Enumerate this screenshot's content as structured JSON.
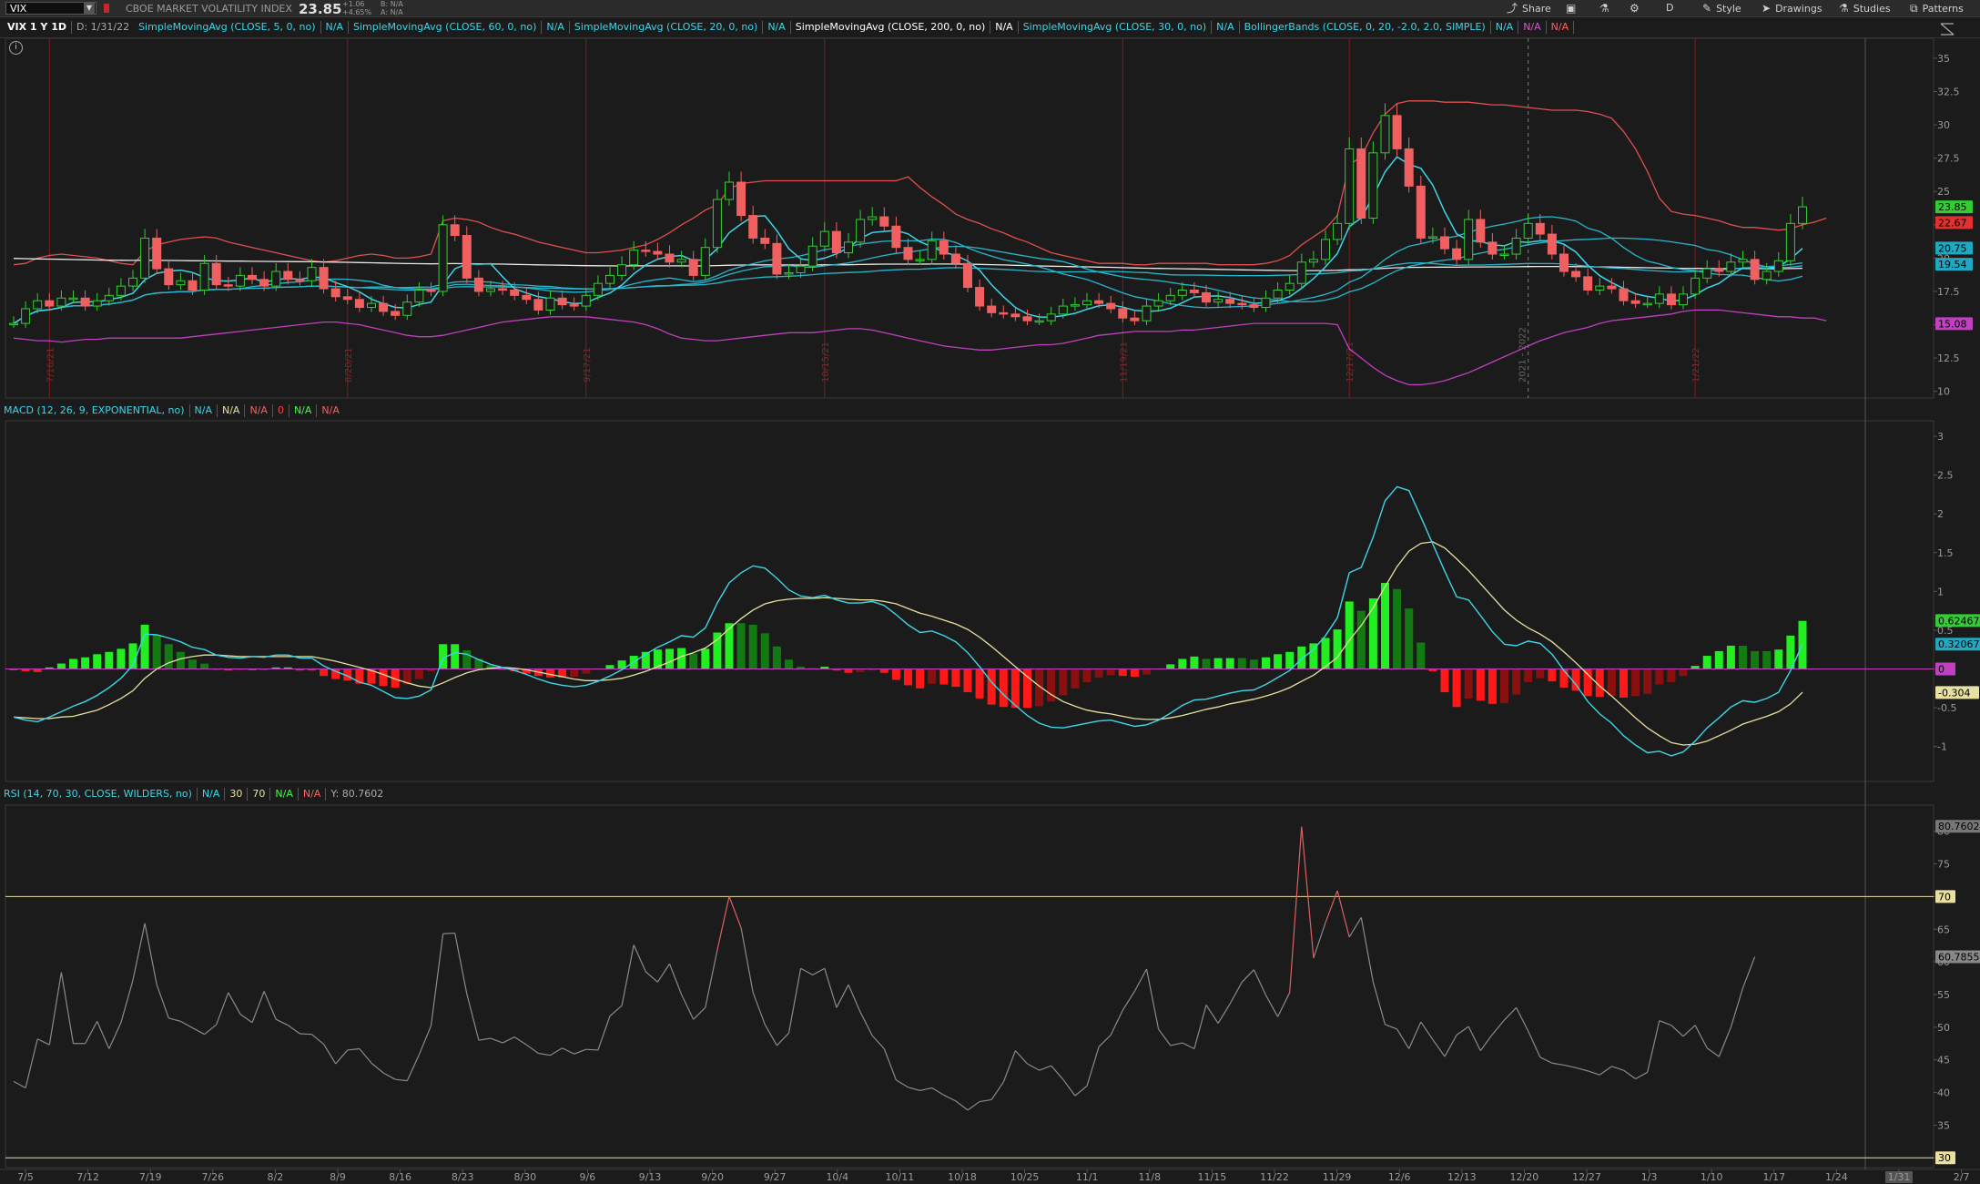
{
  "toolbar": {
    "symbol": "VIX",
    "symbol_name": "CBOE MARKET VOLATILITY INDEX",
    "last": "23.85",
    "net_change": "+1.06",
    "pct_change": "+4.65%",
    "bid": "B: N/A",
    "ask": "A: N/A",
    "buttons": [
      {
        "icon": "share-icon",
        "label": "Share",
        "glyph": "⤴"
      },
      {
        "icon": "layout-icon",
        "label": "",
        "glyph": "▣"
      },
      {
        "icon": "flask-icon",
        "label": "",
        "glyph": "⚗"
      },
      {
        "icon": "gear-icon",
        "label": "",
        "glyph": "⚙"
      },
      {
        "icon": "",
        "label": "D",
        "glyph": ""
      },
      {
        "icon": "style-icon",
        "label": "Style",
        "glyph": "✎"
      },
      {
        "icon": "cursor-icon",
        "label": "Drawings",
        "glyph": "➤"
      },
      {
        "icon": "flask-icon",
        "label": "Studies",
        "glyph": "⚗"
      },
      {
        "icon": "patterns-icon",
        "label": "Patterns",
        "glyph": "⧉"
      }
    ]
  },
  "studies": {
    "period": "VIX 1 Y 1D",
    "date": "D: 1/31/22",
    "items": [
      {
        "label": "SimpleMovingAvg (CLOSE, 5, 0, no)",
        "value": "N/A",
        "color": "#3dd6e8"
      },
      {
        "label": "SimpleMovingAvg (CLOSE, 60, 0, no)",
        "value": "N/A",
        "color": "#3dd6e8"
      },
      {
        "label": "SimpleMovingAvg (CLOSE, 20, 0, no)",
        "value": "N/A",
        "color": "#3dd6e8"
      },
      {
        "label": "SimpleMovingAvg (CLOSE, 200, 0, no)",
        "value": "N/A",
        "color": "#ffffff"
      },
      {
        "label": "SimpleMovingAvg (CLOSE, 30, 0, no)",
        "value": "N/A",
        "color": "#3dd6e8"
      },
      {
        "label": "BollingerBands (CLOSE, 0, 20, -2.0, 2.0, SIMPLE)",
        "value": "N/A",
        "color": "#3dd6e8"
      }
    ],
    "extra": [
      {
        "value": "N/A",
        "color": "#d05bd0"
      },
      {
        "value": "N/A",
        "color": "#ff6060"
      }
    ]
  },
  "macd_label": {
    "title": "MACD (12, 26, 9, EXPONENTIAL, no)",
    "values": [
      {
        "v": "N/A",
        "color": "#3dd6e8"
      },
      {
        "v": "N/A",
        "color": "#e8e0a0"
      },
      {
        "v": "N/A",
        "color": "#ff6060"
      },
      {
        "v": "0",
        "color": "#ff4040"
      },
      {
        "v": "N/A",
        "color": "#40ff40"
      },
      {
        "v": "N/A",
        "color": "#ff6060"
      }
    ]
  },
  "rsi_label": {
    "title": "RSI (14, 70, 30, CLOSE, WILDERS, no)",
    "values": [
      {
        "v": "N/A",
        "color": "#3dd6e8"
      },
      {
        "v": "30",
        "color": "#e8e0a0"
      },
      {
        "v": "70",
        "color": "#e8e0a0"
      },
      {
        "v": "N/A",
        "color": "#40ff40"
      },
      {
        "v": "N/A",
        "color": "#ff6060"
      },
      {
        "v": "Y: 80.7602",
        "color": "#aaaaaa"
      }
    ]
  },
  "chart_data": {
    "type": "candlestick",
    "x_ticks": [
      "7/5",
      "7/12",
      "7/19",
      "7/26",
      "8/2",
      "8/9",
      "8/16",
      "8/23",
      "8/30",
      "9/6",
      "9/13",
      "9/20",
      "9/27",
      "10/4",
      "10/11",
      "10/18",
      "10/25",
      "11/1",
      "11/8",
      "11/15",
      "11/22",
      "11/29",
      "12/6",
      "12/13",
      "12/20",
      "12/27",
      "1/3",
      "1/10",
      "1/17",
      "1/24",
      "1/31",
      "2/7"
    ],
    "x_highlight": "1/31",
    "price": {
      "ylim": [
        9.5,
        36.5
      ],
      "y_ticks": [
        10,
        12.5,
        15,
        17.5,
        20,
        22.5,
        25,
        27.5,
        30,
        32.5,
        35
      ],
      "markers": [
        {
          "value": 23.85,
          "label": "23.85",
          "color": "#33cc33"
        },
        {
          "value": 22.67,
          "label": "22.67",
          "color": "#e03030"
        },
        {
          "value": 20.75,
          "label": "20.75",
          "color": "#20a8c0"
        },
        {
          "value": 19.54,
          "label": "19.54",
          "color": "#20a8c0"
        },
        {
          "value": 15.08,
          "label": "15.08",
          "color": "#c040c0"
        }
      ],
      "expiration_lines": [
        {
          "label": "7/16/21",
          "i": 3
        },
        {
          "label": "8/20/21",
          "i": 28
        },
        {
          "label": "9/17/21",
          "i": 48
        },
        {
          "label": "10/15/21",
          "i": 68
        },
        {
          "label": "11/19/21",
          "i": 93
        },
        {
          "label": "12/17/21",
          "i": 112
        },
        {
          "label": "1/21/22",
          "i": 141
        }
      ],
      "year_line": {
        "label": "2021 - 2022",
        "i": 127
      },
      "closes": [
        15.1,
        16.2,
        16.8,
        16.4,
        17.0,
        17.0,
        16.4,
        16.8,
        17.2,
        17.9,
        18.5,
        21.5,
        19.2,
        18.0,
        18.3,
        17.6,
        19.6,
        18.0,
        17.9,
        18.7,
        18.4,
        17.9,
        19.0,
        18.4,
        18.3,
        19.3,
        17.7,
        17.1,
        16.9,
        16.3,
        16.6,
        16.0,
        15.7,
        16.7,
        17.6,
        17.5,
        22.5,
        21.7,
        18.5,
        17.5,
        17.7,
        17.6,
        17.2,
        16.9,
        16.1,
        17.0,
        16.5,
        16.4,
        17.2,
        18.1,
        18.7,
        19.5,
        20.6,
        20.5,
        20.3,
        19.7,
        19.9,
        18.7,
        20.8,
        24.4,
        25.7,
        23.2,
        21.5,
        21.1,
        18.8,
        18.9,
        19.4,
        20.9,
        22.0,
        20.4,
        21.2,
        22.9,
        23.1,
        22.4,
        20.8,
        19.9,
        19.9,
        21.3,
        20.3,
        19.6,
        17.8,
        16.4,
        15.9,
        15.8,
        15.6,
        15.3,
        15.3,
        15.8,
        16.4,
        16.5,
        16.8,
        16.6,
        16.2,
        15.5,
        15.3,
        16.4,
        16.8,
        17.2,
        17.6,
        17.4,
        16.7,
        16.9,
        16.6,
        16.5,
        16.3,
        17.0,
        17.6,
        18.1,
        19.7,
        19.9,
        21.4,
        22.6,
        28.2,
        23.0,
        27.9,
        30.7,
        28.2,
        25.4,
        21.5,
        21.6,
        20.7,
        19.9,
        22.9,
        21.2,
        20.3,
        20.3,
        21.5,
        22.6,
        21.8,
        20.3,
        19.0,
        18.6,
        17.6,
        17.9,
        17.7,
        16.8,
        16.6,
        16.6,
        17.3,
        16.5,
        17.3,
        18.5,
        19.2,
        19.0,
        19.7,
        19.9,
        18.4,
        19.0,
        19.8,
        22.6,
        23.85
      ],
      "bollinger_upper": [
        19.5,
        19.6,
        20.0,
        20.2,
        20.3,
        20.2,
        20.1,
        20.0,
        19.8,
        19.6,
        19.5,
        20.5,
        21.0,
        21.2,
        21.4,
        21.5,
        21.6,
        21.5,
        21.2,
        21.0,
        20.8,
        20.6,
        20.4,
        20.2,
        20.0,
        19.8,
        19.7,
        19.8,
        20.0,
        20.2,
        20.3,
        20.2,
        20.0,
        20.0,
        20.1,
        20.3,
        22.8,
        23.0,
        22.9,
        22.7,
        22.3,
        22.0,
        21.8,
        21.5,
        21.2,
        21.0,
        20.8,
        20.6,
        20.4,
        20.4,
        20.5,
        20.6,
        20.8,
        21.0,
        21.4,
        21.9,
        22.5,
        23.0,
        23.6,
        24.0,
        25.2,
        25.6,
        25.7,
        25.8,
        25.8,
        25.8,
        25.8,
        25.8,
        25.8,
        25.8,
        25.8,
        25.8,
        25.8,
        25.8,
        25.8,
        26.1,
        25.3,
        24.6,
        24.0,
        23.3,
        22.9,
        22.6,
        22.2,
        21.9,
        21.5,
        21.2,
        20.8,
        20.4,
        20.2,
        20.0,
        19.8,
        19.6,
        19.6,
        19.6,
        19.5,
        19.5,
        19.6,
        19.6,
        19.6,
        19.6,
        19.6,
        19.5,
        19.5,
        19.5,
        19.5,
        19.6,
        19.8,
        20.2,
        21.0,
        21.6,
        22.2,
        23.2,
        27.0,
        27.6,
        29.4,
        30.8,
        31.6,
        31.8,
        31.8,
        31.8,
        31.7,
        31.7,
        31.7,
        31.6,
        31.5,
        31.5,
        31.4,
        31.3,
        31.2,
        31.1,
        31.1,
        31.1,
        31.0,
        30.8,
        30.5,
        29.5,
        28.2,
        26.5,
        24.5,
        23.5,
        23.3,
        23.2,
        23.0,
        22.8,
        22.5,
        22.3,
        22.3,
        22.2,
        22.1,
        22.2,
        22.5,
        22.7,
        23.0
      ],
      "bollinger_lower": [
        14.0,
        13.9,
        13.8,
        13.8,
        13.7,
        13.8,
        13.9,
        13.9,
        14.0,
        14.0,
        14.0,
        14.0,
        14.0,
        14.0,
        14.0,
        14.1,
        14.2,
        14.3,
        14.4,
        14.5,
        14.6,
        14.7,
        14.8,
        14.9,
        15.0,
        15.1,
        15.2,
        15.2,
        15.1,
        15.0,
        14.8,
        14.6,
        14.4,
        14.2,
        14.1,
        14.1,
        14.2,
        14.4,
        14.6,
        14.8,
        15.0,
        15.2,
        15.3,
        15.4,
        15.5,
        15.6,
        15.6,
        15.6,
        15.6,
        15.5,
        15.4,
        15.3,
        15.2,
        15.0,
        14.7,
        14.3,
        14.0,
        13.9,
        13.8,
        13.8,
        13.9,
        14.0,
        14.1,
        14.2,
        14.3,
        14.4,
        14.4,
        14.4,
        14.5,
        14.6,
        14.7,
        14.7,
        14.6,
        14.4,
        14.2,
        14.0,
        13.8,
        13.6,
        13.4,
        13.3,
        13.2,
        13.1,
        13.1,
        13.2,
        13.3,
        13.4,
        13.5,
        13.5,
        13.6,
        13.8,
        14.0,
        14.2,
        14.3,
        14.4,
        14.5,
        14.5,
        14.5,
        14.5,
        14.6,
        14.6,
        14.7,
        14.8,
        14.9,
        15.0,
        15.1,
        15.1,
        15.1,
        15.1,
        15.1,
        15.1,
        15.1,
        15.0,
        13.2,
        12.5,
        11.8,
        11.2,
        10.8,
        10.5,
        10.5,
        10.6,
        10.8,
        11.1,
        11.4,
        11.8,
        12.2,
        12.6,
        13.0,
        13.4,
        13.8,
        14.1,
        14.4,
        14.6,
        14.8,
        15.1,
        15.3,
        15.4,
        15.5,
        15.6,
        15.7,
        15.8,
        16.0,
        16.1,
        16.1,
        16.1,
        16.0,
        15.9,
        15.8,
        15.7,
        15.6,
        15.6,
        15.5,
        15.5,
        15.3
      ]
    },
    "macd": {
      "ylim": [
        -1.45,
        3.2
      ],
      "y_ticks": [
        -1,
        -0.5,
        0,
        0.5,
        1,
        1.5,
        2,
        2.5,
        3
      ],
      "markers": [
        {
          "value": 0.62467,
          "label": "0.62467",
          "color": "#33cc33"
        },
        {
          "value": 0.32067,
          "label": "0.32067",
          "color": "#20a8c0"
        },
        {
          "value": 0,
          "label": "0",
          "color": "#c040c0"
        },
        {
          "value": -0.304,
          "label": "-0.304",
          "color": "#e8e0a0"
        }
      ],
      "macd_line": [
        -0.62,
        -0.66,
        -0.68,
        -0.62,
        -0.55,
        -0.48,
        -0.42,
        -0.34,
        -0.24,
        -0.12,
        0.05,
        0.45,
        0.44,
        0.4,
        0.35,
        0.28,
        0.25,
        0.18,
        0.15,
        0.14,
        0.16,
        0.15,
        0.18,
        0.18,
        0.14,
        0.14,
        0.04,
        -0.03,
        -0.09,
        -0.17,
        -0.21,
        -0.29,
        -0.37,
        -0.38,
        -0.35,
        -0.27,
        0.14,
        0.21,
        0.19,
        0.12,
        0.06,
        0.02,
        -0.02,
        -0.07,
        -0.13,
        -0.18,
        -0.21,
        -0.23,
        -0.21,
        -0.16,
        -0.09,
        -0.01,
        0.09,
        0.19,
        0.28,
        0.35,
        0.43,
        0.41,
        0.53,
        0.85,
        1.11,
        1.24,
        1.33,
        1.3,
        1.17,
        1.02,
        0.94,
        0.92,
        0.95,
        0.89,
        0.85,
        0.85,
        0.87,
        0.82,
        0.7,
        0.57,
        0.47,
        0.49,
        0.43,
        0.35,
        0.21,
        0.03,
        -0.17,
        -0.33,
        -0.47,
        -0.6,
        -0.7,
        -0.75,
        -0.76,
        -0.73,
        -0.7,
        -0.67,
        -0.66,
        -0.7,
        -0.74,
        -0.72,
        -0.66,
        -0.57,
        -0.47,
        -0.4,
        -0.39,
        -0.35,
        -0.31,
        -0.28,
        -0.27,
        -0.2,
        -0.11,
        -0.02,
        0.13,
        0.25,
        0.43,
        0.66,
        1.24,
        1.31,
        1.7,
        2.17,
        2.35,
        2.3,
        1.96,
        1.61,
        1.26,
        0.93,
        0.89,
        0.69,
        0.48,
        0.32,
        0.3,
        0.36,
        0.33,
        0.19,
        -0.02,
        -0.2,
        -0.42,
        -0.58,
        -0.7,
        -0.86,
        -0.98,
        -1.08,
        -1.06,
        -1.12,
        -1.07,
        -0.93,
        -0.76,
        -0.63,
        -0.49,
        -0.41,
        -0.43,
        -0.38,
        -0.3,
        -0.02,
        0.32
      ],
      "signal_line": [
        -0.62,
        -0.63,
        -0.64,
        -0.64,
        -0.62,
        -0.61,
        -0.57,
        -0.53,
        -0.46,
        -0.38,
        -0.28,
        -0.12,
        0.0,
        0.08,
        0.13,
        0.16,
        0.18,
        0.18,
        0.17,
        0.16,
        0.16,
        0.16,
        0.16,
        0.16,
        0.16,
        0.16,
        0.13,
        0.1,
        0.06,
        0.02,
        -0.02,
        -0.07,
        -0.13,
        -0.18,
        -0.22,
        -0.24,
        -0.18,
        -0.11,
        -0.05,
        -0.01,
        0.01,
        0.02,
        0.01,
        -0.01,
        -0.04,
        -0.07,
        -0.1,
        -0.13,
        -0.15,
        -0.15,
        -0.14,
        -0.12,
        -0.08,
        -0.03,
        0.03,
        0.09,
        0.16,
        0.21,
        0.27,
        0.38,
        0.52,
        0.65,
        0.76,
        0.84,
        0.88,
        0.9,
        0.91,
        0.91,
        0.92,
        0.91,
        0.9,
        0.89,
        0.89,
        0.87,
        0.84,
        0.78,
        0.72,
        0.68,
        0.63,
        0.58,
        0.51,
        0.41,
        0.29,
        0.16,
        0.03,
        -0.1,
        -0.22,
        -0.33,
        -0.42,
        -0.48,
        -0.53,
        -0.56,
        -0.58,
        -0.61,
        -0.64,
        -0.65,
        -0.65,
        -0.63,
        -0.6,
        -0.56,
        -0.52,
        -0.49,
        -0.45,
        -0.42,
        -0.39,
        -0.35,
        -0.3,
        -0.24,
        -0.16,
        -0.08,
        0.03,
        0.15,
        0.37,
        0.56,
        0.79,
        1.06,
        1.32,
        1.52,
        1.62,
        1.64,
        1.56,
        1.42,
        1.27,
        1.1,
        0.93,
        0.76,
        0.63,
        0.53,
        0.45,
        0.35,
        0.22,
        0.08,
        -0.07,
        -0.22,
        -0.35,
        -0.49,
        -0.63,
        -0.76,
        -0.86,
        -0.95,
        -0.98,
        -0.97,
        -0.93,
        -0.86,
        -0.79,
        -0.71,
        -0.66,
        -0.61,
        -0.55,
        -0.45,
        -0.3
      ]
    },
    "rsi": {
      "ylim": [
        28.5,
        84
      ],
      "y_ticks": [
        30,
        35,
        40,
        45,
        50,
        55,
        60,
        65,
        70,
        75,
        80
      ],
      "overbought": 70,
      "oversold": 30,
      "markers": [
        {
          "value": 80.7602,
          "label": "80.7602",
          "color": "#777777"
        },
        {
          "value": 70,
          "label": "70",
          "color": "#e8e0a0"
        },
        {
          "value": 60.7855,
          "label": "60.7855",
          "color": "#888888"
        },
        {
          "value": 30,
          "label": "30",
          "color": "#e8e0a0"
        }
      ],
      "values": [
        41.7,
        40.7,
        48.2,
        47.3,
        58.4,
        47.5,
        47.5,
        50.9,
        46.7,
        50.7,
        57.2,
        65.9,
        56.5,
        51.4,
        50.9,
        49.9,
        48.9,
        50.4,
        55.3,
        52.0,
        50.7,
        55.5,
        51.2,
        50.3,
        49.0,
        48.9,
        47.4,
        44.4,
        46.5,
        46.7,
        44.5,
        43.0,
        42.0,
        41.8,
        45.8,
        50.2,
        64.3,
        64.4,
        55.1,
        48.0,
        48.3,
        47.6,
        48.5,
        47.3,
        46.0,
        45.7,
        46.8,
        45.9,
        46.6,
        46.5,
        51.7,
        53.3,
        62.6,
        58.5,
        56.9,
        59.7,
        55.0,
        51.2,
        53.0,
        61.8,
        70.0,
        65.2,
        55.3,
        50.4,
        47.2,
        49.1,
        59.0,
        58.0,
        59.0,
        53.0,
        56.5,
        52.3,
        48.7,
        46.7,
        41.9,
        40.8,
        40.3,
        40.7,
        39.6,
        38.7,
        37.3,
        38.6,
        38.9,
        41.6,
        46.4,
        44.4,
        43.4,
        44.1,
        42.0,
        39.5,
        41.0,
        47.0,
        48.8,
        52.6,
        55.5,
        58.9,
        49.7,
        47.2,
        47.6,
        46.7,
        53.4,
        50.6,
        53.6,
        56.9,
        58.8,
        54.9,
        51.6,
        55.3,
        80.7,
        60.6,
        66.0,
        70.9,
        63.8,
        66.8,
        56.9,
        50.4,
        49.7,
        46.7,
        50.8,
        48.1,
        45.5,
        48.8,
        50.1,
        46.4,
        48.9,
        51.1,
        53.0,
        49.4,
        45.4,
        44.5,
        44.2,
        43.8,
        43.3,
        42.7,
        44.0,
        43.4,
        42.1,
        43.1,
        51.0,
        50.3,
        48.6,
        50.3,
        46.8,
        45.5,
        50.0,
        56.0,
        60.7855
      ]
    }
  }
}
